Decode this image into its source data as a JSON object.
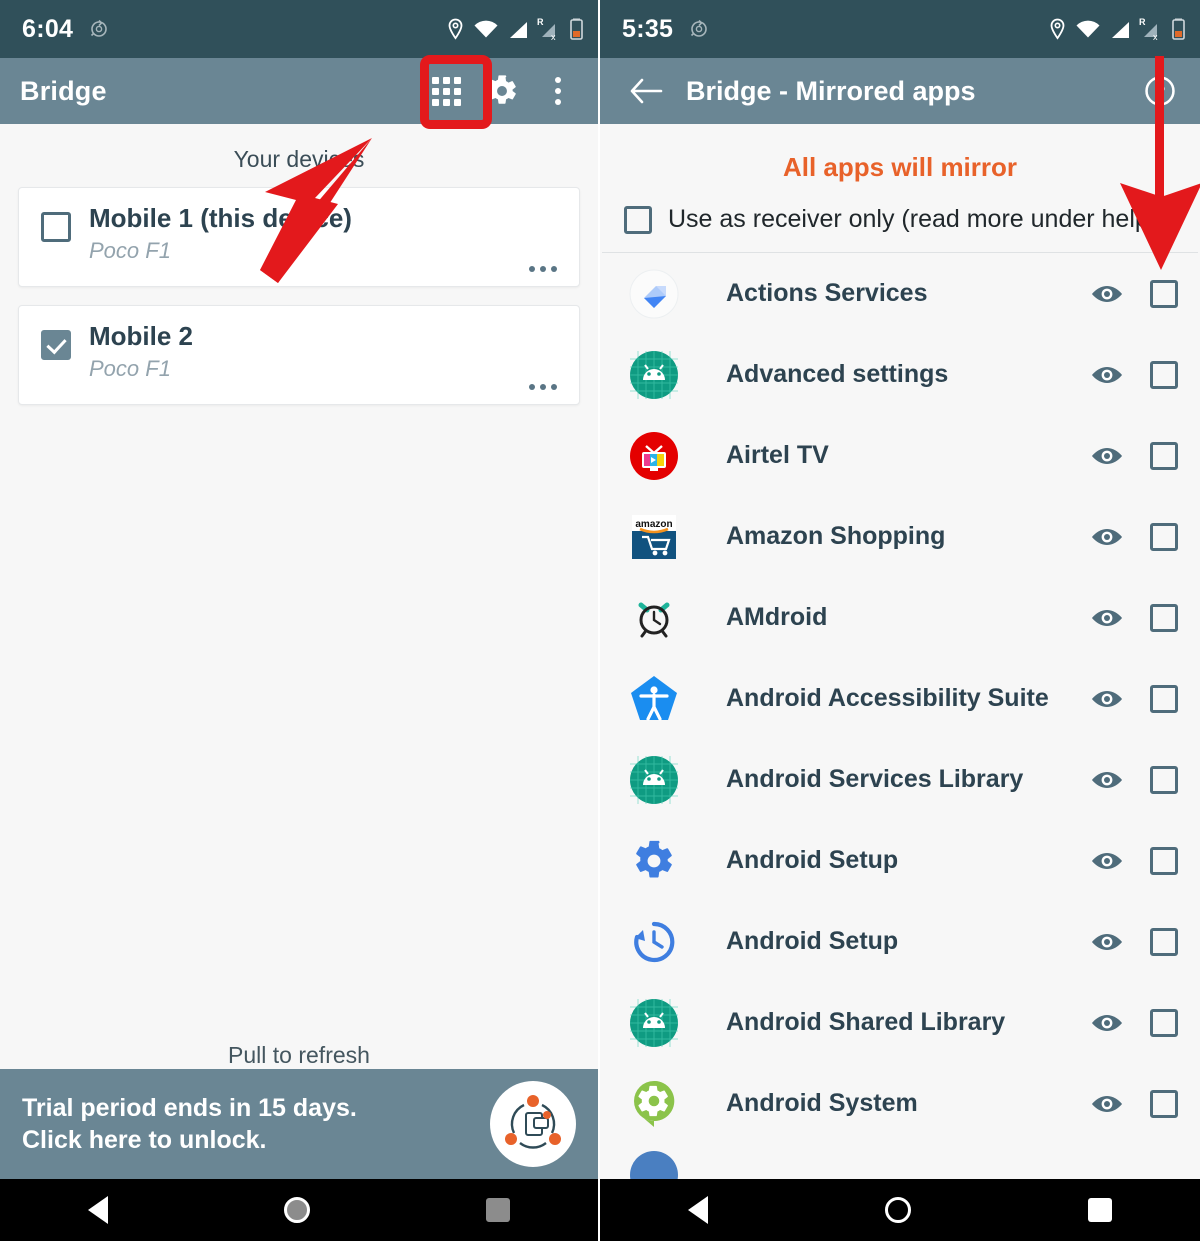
{
  "left_phone": {
    "status_bar": {
      "time": "6:04",
      "icons": [
        "rotation-icon",
        "location-icon",
        "wifi-icon",
        "signal-icon",
        "signal-roaming-icon",
        "battery-icon"
      ]
    },
    "toolbar": {
      "title": "Bridge",
      "actions": [
        {
          "name": "apps-grid-button",
          "icon": "grid-icon"
        },
        {
          "name": "settings-button",
          "icon": "gear-icon"
        },
        {
          "name": "overflow-button",
          "icon": "kebab-menu-icon"
        }
      ]
    },
    "section_header": "Your devices",
    "devices": [
      {
        "name": "Mobile 1 (this device)",
        "model": "Poco F1",
        "checked": false,
        "menu": "more-options-icon"
      },
      {
        "name": "Mobile 2",
        "model": "Poco F1",
        "checked": true,
        "menu": "more-options-icon"
      }
    ],
    "pull_hint": "Pull to refresh",
    "trial_banner": {
      "line1": "Trial period ends in 15 days.",
      "line2": "Click here to unlock.",
      "icon": "bridge-network-logo"
    },
    "nav_bar": [
      "back-icon",
      "home-icon",
      "recents-icon"
    ]
  },
  "right_phone": {
    "status_bar": {
      "time": "5:35",
      "icons": [
        "rotation-icon",
        "location-icon",
        "wifi-icon",
        "signal-icon",
        "signal-roaming-icon",
        "battery-icon"
      ]
    },
    "toolbar": {
      "back": "back-arrow-icon",
      "title": "Bridge - Mirrored apps",
      "help": "help-circle-icon"
    },
    "mirror_status": "All apps will mirror",
    "receiver_option": {
      "label": "Use as receiver only (read more under help)",
      "checked": false
    },
    "column_icons": {
      "preview": "eye-icon",
      "select": "checkbox"
    },
    "apps": [
      {
        "label": "Actions Services",
        "icon": "actions-services-icon",
        "checked": false
      },
      {
        "label": "Advanced settings",
        "icon": "android-green-icon",
        "checked": false
      },
      {
        "label": "Airtel TV",
        "icon": "airtel-tv-icon",
        "checked": false
      },
      {
        "label": "Amazon Shopping",
        "icon": "amazon-shopping-icon",
        "checked": false
      },
      {
        "label": "AMdroid",
        "icon": "amdroid-clock-icon",
        "checked": false
      },
      {
        "label": "Android Accessibility Suite",
        "icon": "accessibility-icon",
        "checked": false
      },
      {
        "label": "Android Services Library",
        "icon": "android-green-icon",
        "checked": false
      },
      {
        "label": "Android Setup",
        "icon": "blue-gear-icon",
        "checked": false
      },
      {
        "label": "Android Setup",
        "icon": "history-clock-icon",
        "checked": false
      },
      {
        "label": "Android Shared Library",
        "icon": "android-green-icon",
        "checked": false
      },
      {
        "label": "Android System",
        "icon": "green-gear-icon",
        "checked": false
      }
    ],
    "nav_bar": [
      "back-icon",
      "home-icon",
      "recents-icon"
    ]
  },
  "annotations": {
    "highlight_box_target": "apps-grid-button",
    "arrow_left_target": "apps-grid-button",
    "arrow_right_target": "select-all-checkbox-column",
    "color": "#e3191c"
  },
  "colors": {
    "status_bar": "#30505a",
    "toolbar": "#6a8694",
    "accent_orange": "#e8622a",
    "text_dark": "#2d4350",
    "page_bg": "#f7f7f7",
    "annotation_red": "#e3191c"
  }
}
